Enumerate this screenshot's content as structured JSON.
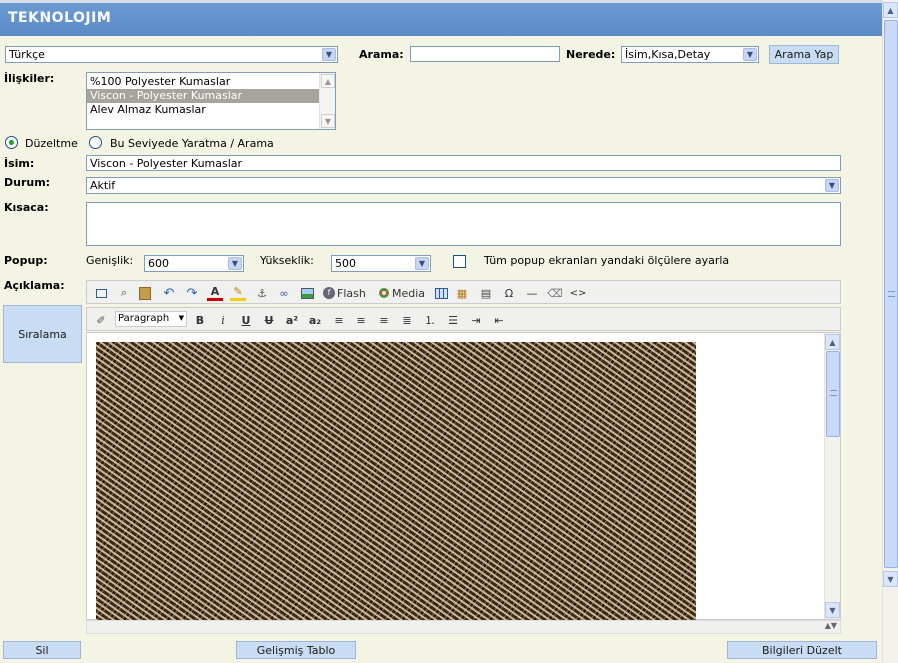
{
  "header": {
    "logo": "TEKNOLOJIM"
  },
  "search": {
    "language": "Türkçe",
    "arama_label": "Arama:",
    "arama_value": "",
    "nerede_label": "Nerede:",
    "nerede_value": "İsim,Kısa,Detay",
    "button": "Arama Yap"
  },
  "relations": {
    "label": "İlişkiler:",
    "items": [
      "%100 Polyester Kumaslar",
      "Viscon - Polyester Kumaslar",
      "Alev Almaz Kumaslar"
    ],
    "selected_index": 1
  },
  "mode": {
    "option1": "Düzeltme",
    "option2": "Bu Seviyede Yaratma / Arama",
    "selected": "option1"
  },
  "fields": {
    "isim_label": "İsim:",
    "isim_value": "Viscon - Polyester Kumaslar",
    "durum_label": "Durum:",
    "durum_value": "Aktif",
    "kisaca_label": "Kısaca:",
    "kisaca_value": ""
  },
  "popup": {
    "label": "Popup:",
    "genislik_label": "Genişlik:",
    "genislik_value": "600",
    "yukseklik_label": "Yükseklik:",
    "yukseklik_value": "500",
    "checkbox_label": "Tüm popup ekranları yandaki ölçülere ayarla",
    "checked": false
  },
  "aciklama": {
    "label": "Açıklama:",
    "flash_label": "Flash",
    "media_label": "Media",
    "format_value": "Paragraph"
  },
  "side": {
    "siralama": "Sıralama"
  },
  "footer": {
    "sil": "Sil",
    "gelismis": "Gelişmiş Tablo",
    "bilgileri": "Bilgileri Düzelt"
  },
  "colors": {
    "header": "#5b8ac6",
    "background": "#f4f4e4",
    "button": "#c8dcf3",
    "selected_item": "#a5a39c"
  }
}
